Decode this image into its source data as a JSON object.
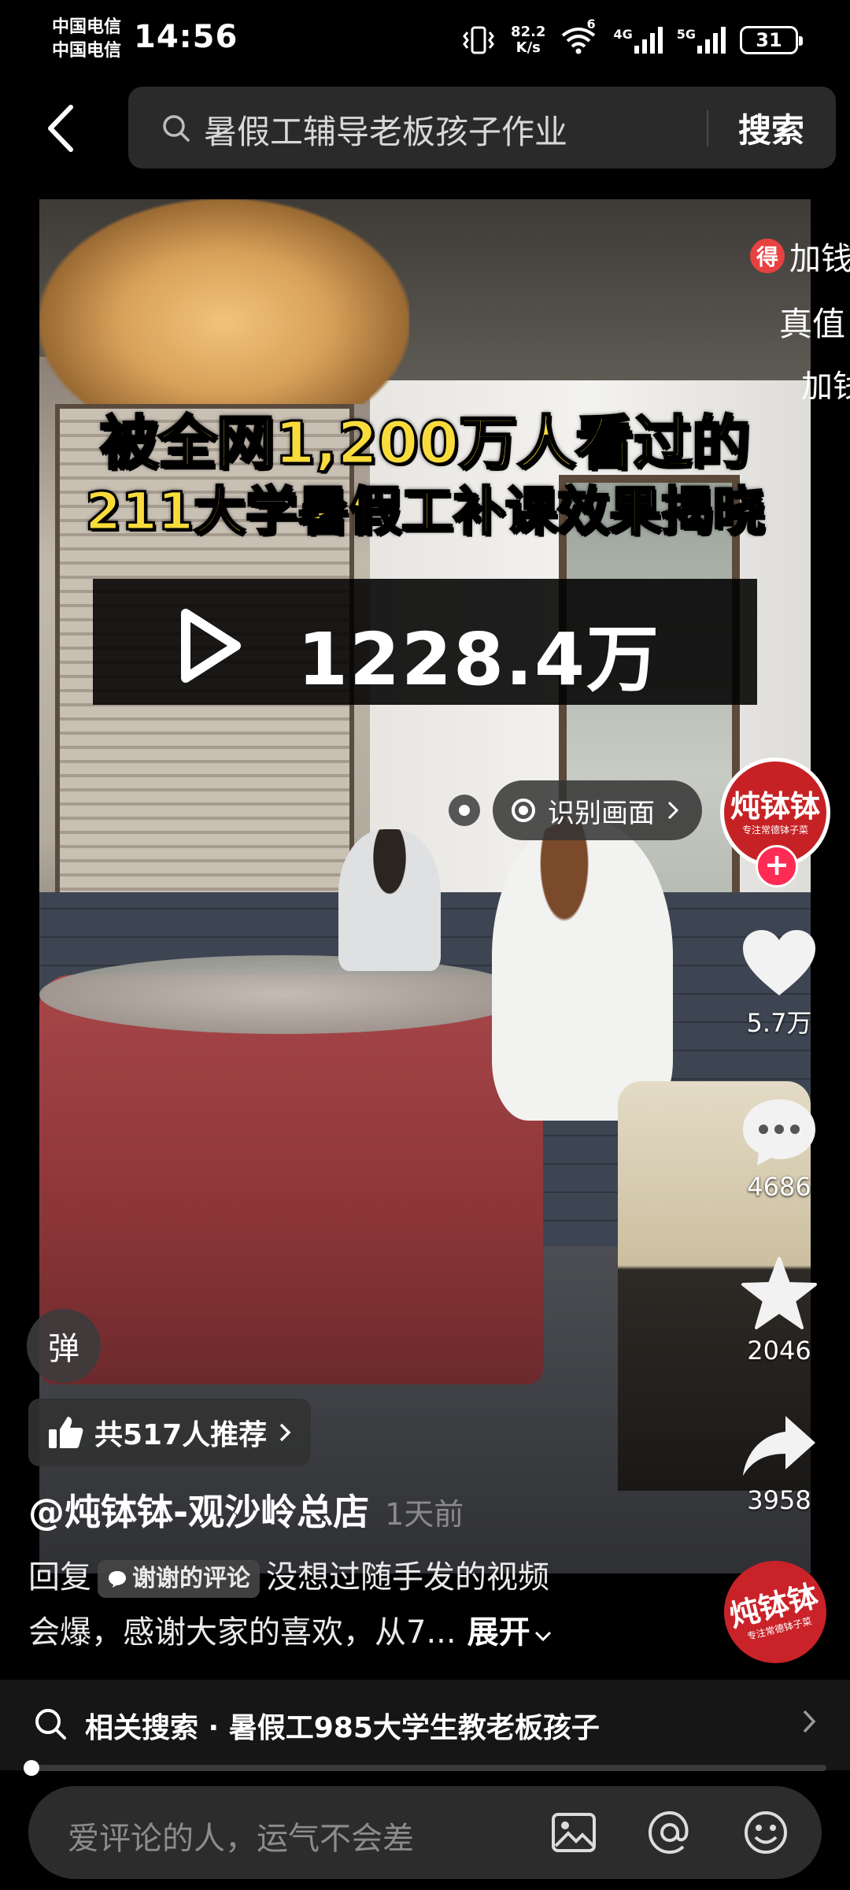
{
  "status_bar": {
    "carrier_1": "中国电信",
    "carrier_2": "中国电信",
    "time": "14:56",
    "net_speed_value": "82.2",
    "net_speed_unit": "K/s",
    "wifi_sup": "6",
    "net_4g": "4G",
    "net_5g": "5G",
    "battery": "31"
  },
  "search": {
    "query": "暑假工辅导老板孩子作业",
    "button": "搜索"
  },
  "video": {
    "headline_line1": "被全网1,200万人看过的",
    "headline_line2": "211大学暑假工补课效果揭晓",
    "view_count": "1228.4万",
    "identify_label": "识别画面"
  },
  "ad_overlay": {
    "badge": "得",
    "line1": "加钱",
    "line2": "真值",
    "line3": "加钱"
  },
  "actions": {
    "avatar_text": "炖钵钵",
    "avatar_sub": "专注常德钵子菜",
    "follow": "+",
    "likes": "5.7万",
    "comments": "4686",
    "favorites": "2046",
    "shares": "3958"
  },
  "danmu_label": "弹",
  "recommend": "共517人推荐",
  "author": {
    "name": "@炖钵钵-观沙岭总店",
    "time": "1天前"
  },
  "description": {
    "reply_prefix": "回复",
    "reply_chip": "谢谢的评论",
    "text_line1": "没想过随手发的视频",
    "text_line2": "会爆，感谢大家的喜欢，从7...",
    "expand": "展开"
  },
  "brand_logo": {
    "text": "炖钵钵",
    "sub": "专注常德钵子菜"
  },
  "related": {
    "text": "相关搜索 · 暑假工985大学生教老板孩子",
    "progress": 0.01
  },
  "comment_bar": {
    "placeholder": "爱评论的人，运气不会差"
  },
  "colors": {
    "headline": "#f9dc3c",
    "accent": "#fe2c55",
    "brand_red": "#c62225"
  }
}
